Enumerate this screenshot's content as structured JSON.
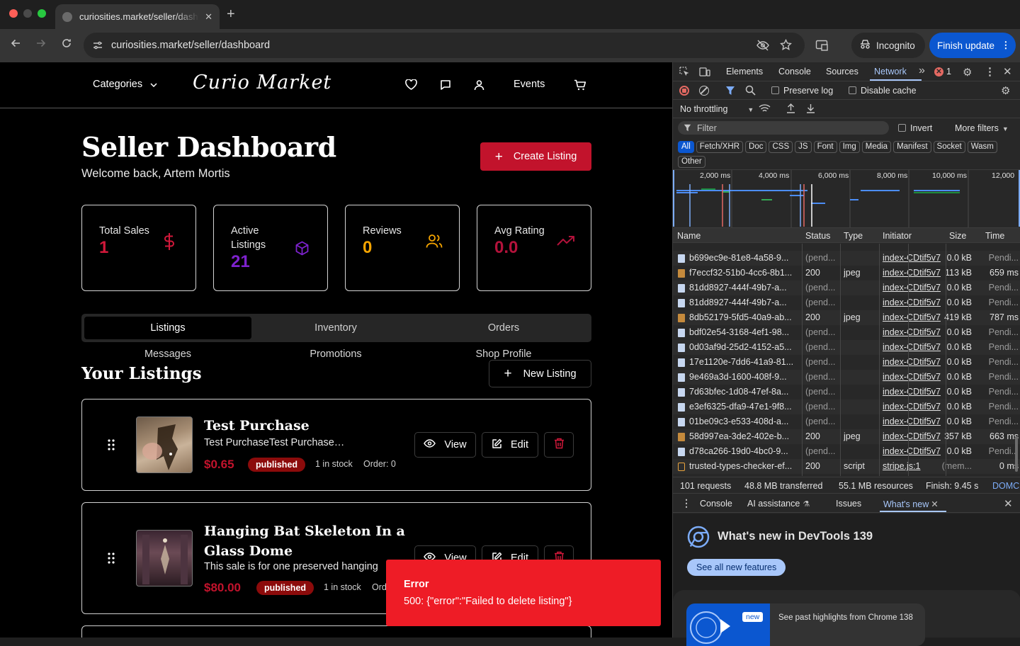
{
  "browser": {
    "tab_title": "curiosities.market/seller/dashboard",
    "url": "curiosities.market/seller/dashboard",
    "incognito_label": "Incognito",
    "update_label": "Finish update",
    "new_tab_glyph": "+",
    "tab_close_glyph": "✕"
  },
  "site": {
    "categories_label": "Categories",
    "logo_text": "Curio Market",
    "events_label": "Events",
    "title": "Seller Dashboard",
    "welcome": "Welcome back, Artem Mortis",
    "create_listing": "Create Listing",
    "stats": [
      {
        "label": "Total Sales",
        "value": "1",
        "color": "#d1183a",
        "icon": "dollar-icon"
      },
      {
        "label": "Active Listings",
        "value": "21",
        "color": "#7e22ce",
        "icon": "cube-icon"
      },
      {
        "label": "Reviews",
        "value": "0",
        "color": "#f5a400",
        "icon": "users-icon"
      },
      {
        "label": "Avg Rating",
        "value": "0.0",
        "color": "#b3123b",
        "icon": "trending-up-icon"
      }
    ],
    "tabs": [
      "Listings",
      "Inventory",
      "Orders"
    ],
    "subtabs": [
      "Messages",
      "Promotions",
      "Shop Profile"
    ],
    "listings_heading": "Your Listings",
    "new_listing": "New Listing",
    "listings": [
      {
        "title": "Test Purchase",
        "description": "Test PurchaseTest Purchase",
        "price": "$0.65",
        "status": "published",
        "stock": "1 in stock",
        "order": "Order: 0"
      },
      {
        "title": "Hanging Bat Skeleton In a Glass Dome",
        "description": "This sale is for one preserved hanging",
        "price": "$80.00",
        "status": "published",
        "stock": "1 in stock",
        "order": "Ord"
      }
    ],
    "view_label": "View",
    "edit_label": "Edit",
    "toast": {
      "title": "Error",
      "message": "500: {\"error\":\"Failed to delete listing\"}"
    }
  },
  "devtools": {
    "tabs": [
      "Elements",
      "Console",
      "Sources",
      "Network"
    ],
    "active_tab": "Network",
    "error_count": "1",
    "preserve_log": "Preserve log",
    "disable_cache": "Disable cache",
    "throttling": "No throttling",
    "filter_placeholder": "Filter",
    "invert": "Invert",
    "more_filters": "More filters",
    "type_filters": [
      "All",
      "Fetch/XHR",
      "Doc",
      "CSS",
      "JS",
      "Font",
      "Img",
      "Media",
      "Manifest",
      "Socket",
      "Wasm",
      "Other"
    ],
    "timeline_ticks": [
      "2,000 ms",
      "4,000 ms",
      "6,000 ms",
      "8,000 ms",
      "10,000 ms",
      "12,000"
    ],
    "columns": [
      "Name",
      "Status",
      "Type",
      "Initiator",
      "Size",
      "Time"
    ],
    "requests": [
      {
        "name": "b699ec9e-81e8-4a58-9...",
        "status": "(pend...",
        "type": "",
        "initiator": "index-CDtif5v7",
        "size": "0.0 kB",
        "time": "Pendi...",
        "icon": "doc"
      },
      {
        "name": "f7eccf32-51b0-4cc6-8b1...",
        "status": "200",
        "type": "jpeg",
        "initiator": "index-CDtif5v7",
        "size": "113 kB",
        "time": "659 ms",
        "icon": "img"
      },
      {
        "name": "81dd8927-444f-49b7-a...",
        "status": "(pend...",
        "type": "",
        "initiator": "index-CDtif5v7",
        "size": "0.0 kB",
        "time": "Pendi...",
        "icon": "doc"
      },
      {
        "name": "81dd8927-444f-49b7-a...",
        "status": "(pend...",
        "type": "",
        "initiator": "index-CDtif5v7",
        "size": "0.0 kB",
        "time": "Pendi...",
        "icon": "doc"
      },
      {
        "name": "8db52179-5fd5-40a9-ab...",
        "status": "200",
        "type": "jpeg",
        "initiator": "index-CDtif5v7",
        "size": "419 kB",
        "time": "787 ms",
        "icon": "img"
      },
      {
        "name": "bdf02e54-3168-4ef1-98...",
        "status": "(pend...",
        "type": "",
        "initiator": "index-CDtif5v7",
        "size": "0.0 kB",
        "time": "Pendi...",
        "icon": "doc"
      },
      {
        "name": "0d03af9d-25d2-4152-a5...",
        "status": "(pend...",
        "type": "",
        "initiator": "index-CDtif5v7",
        "size": "0.0 kB",
        "time": "Pendi...",
        "icon": "doc"
      },
      {
        "name": "17e1120e-7dd6-41a9-81...",
        "status": "(pend...",
        "type": "",
        "initiator": "index-CDtif5v7",
        "size": "0.0 kB",
        "time": "Pendi...",
        "icon": "doc"
      },
      {
        "name": "9e469a3d-1600-408f-9...",
        "status": "(pend...",
        "type": "",
        "initiator": "index-CDtif5v7",
        "size": "0.0 kB",
        "time": "Pendi...",
        "icon": "doc"
      },
      {
        "name": "7d63bfec-1d08-47ef-8a...",
        "status": "(pend...",
        "type": "",
        "initiator": "index-CDtif5v7",
        "size": "0.0 kB",
        "time": "Pendi...",
        "icon": "doc"
      },
      {
        "name": "e3ef6325-dfa9-47e1-9f8...",
        "status": "(pend...",
        "type": "",
        "initiator": "index-CDtif5v7",
        "size": "0.0 kB",
        "time": "Pendi...",
        "icon": "doc"
      },
      {
        "name": "01be09c3-e533-408d-a...",
        "status": "(pend...",
        "type": "",
        "initiator": "index-CDtif5v7",
        "size": "0.0 kB",
        "time": "Pendi...",
        "icon": "doc"
      },
      {
        "name": "58d997ea-3de2-402e-b...",
        "status": "200",
        "type": "jpeg",
        "initiator": "index-CDtif5v7",
        "size": "357 kB",
        "time": "663 ms",
        "icon": "img"
      },
      {
        "name": "d78ca266-19d0-4bc0-9...",
        "status": "(pend...",
        "type": "",
        "initiator": "index-CDtif5v7",
        "size": "0.0 kB",
        "time": "Pendi...",
        "icon": "doc"
      },
      {
        "name": "trusted-types-checker-ef...",
        "status": "200",
        "type": "script",
        "initiator": "stripe.js:1",
        "size": "(mem...",
        "time": "0 ms",
        "icon": "script"
      }
    ],
    "summary": [
      "101 requests",
      "48.8 MB transferred",
      "55.1 MB resources",
      "Finish: 9.45 s",
      "DOMC"
    ],
    "drawer_tabs": [
      "Console",
      "AI assistance",
      "Issues",
      "What's new"
    ],
    "whats_new_title": "What's new in DevTools 139",
    "see_all": "See all new features",
    "past_highlights": "See past highlights from Chrome 138",
    "new_badge": "new"
  }
}
